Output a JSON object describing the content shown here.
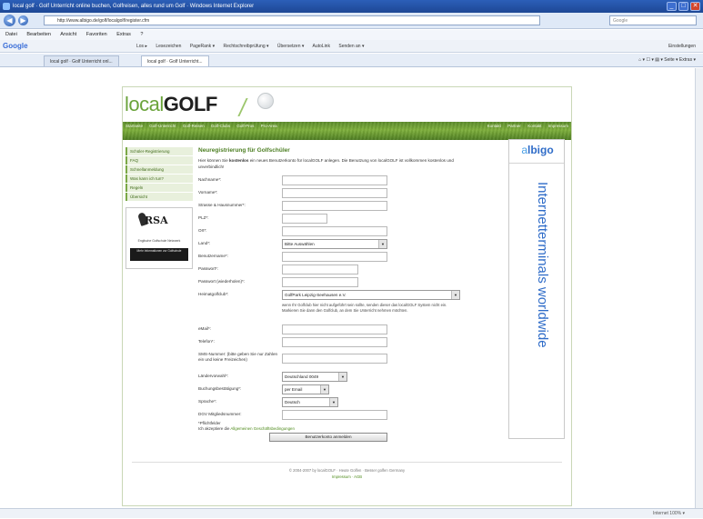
{
  "window": {
    "title": "local golf · Golf Unterricht online buchen, Golfreisen, alles rund um Golf · Windows Internet Explorer",
    "controls": [
      "_",
      "□",
      "✕"
    ]
  },
  "addressbar": {
    "url": "http://www.albigo.de/golf/localgolf/register.cfm",
    "search_placeholder": "Google"
  },
  "menubar": [
    "Datei",
    "Bearbeiten",
    "Ansicht",
    "Favoriten",
    "Extras",
    "?"
  ],
  "google_toolbar": {
    "logo": "Google",
    "items": [
      "Los ▸",
      "Lesezeichen",
      "PageRank ▾",
      "Rechtschreibprüfung ▾",
      "Übersetzen ▾",
      "AutoLink",
      "Senden an ▾"
    ],
    "settings": "Einstellungen"
  },
  "tabs": [
    {
      "label": "local golf · Golf Unterricht onl...",
      "active": false
    },
    {
      "label": "local golf · Golf Unterricht...",
      "active": true
    }
  ],
  "tab_tools": "⌂ ▾  ☐ ▾  ▤ ▾  Seite ▾  Extras ▾",
  "statusbar": {
    "left": "",
    "right": "Internet     100% ▾"
  },
  "site": {
    "logo_light": "local",
    "logo_bold": "GOLF",
    "topnav": [
      "Startseite",
      "Golf-Unterricht",
      "Golf-Reisen",
      "Golf-Clubs",
      "Golf-Pros",
      "Pro-Area"
    ],
    "topnav_right": [
      "Kontakt",
      "Partner",
      "Kontakt",
      "Impressum"
    ],
    "sidenav": [
      "Schüler-Registrierung",
      "FAQ",
      "Schnellanmeldung",
      "Was kann ich tun?",
      "Regeln",
      "Übersicht"
    ],
    "rsa": {
      "logo": "RSA",
      "caption": "Englische Golfschule Netzwerk",
      "bar": "Mehr Informationen zur Golfschule"
    },
    "heading": "Neuregistrierung für Golfschüler",
    "intro_a": "Hier können Sie ",
    "intro_bold": "kostenlos",
    "intro_b": " ein neues Benutzerkonto für localGOLF anlegen. Die Benutzung von localGOLF ist vollkommen kostenlos und unverbindlich!",
    "fields": [
      {
        "label": "Nachname*:",
        "type": "input",
        "w": 116
      },
      {
        "label": "Vorname*:",
        "type": "input",
        "w": 116
      },
      {
        "label": "Strasse & Hausnummer*:",
        "type": "input",
        "w": 116
      },
      {
        "label": "PLZ*:",
        "type": "input",
        "w": 50
      },
      {
        "label": "Ort*:",
        "type": "input",
        "w": 116
      },
      {
        "label": "Land*:",
        "type": "select",
        "value": "Bitte Auswählen",
        "w": 116
      },
      {
        "label": "Benutzername*:",
        "type": "input",
        "w": 116
      },
      {
        "label": "Passwort*:",
        "type": "input",
        "w": 84
      },
      {
        "label": "Passwort (wiederholen)*:",
        "type": "input",
        "w": 84
      }
    ],
    "homegolfclub": {
      "label": "Heimatgolfclub*:",
      "value": "GolfPark Leipzig-Seehausen e.V.",
      "hint": "wenn Ihr Golfclub hier nicht aufgeführt sein sollte, senden dieser das localGOLF System nicht ein. Markieren Sie dann den Golfclub, an dem Sie Unterricht nehmen möchten."
    },
    "fields2": [
      {
        "label": "eMail*:",
        "type": "input",
        "w": 116
      },
      {
        "label": "Telefon*:",
        "type": "input",
        "w": 116
      }
    ],
    "sms": {
      "label": "SMS-Nummer: (bitte geben Sie nur Zahlen ein und keine Freizeichen)",
      "w": 116
    },
    "selects": [
      {
        "label": "Ländervorwahl*:",
        "value": "Deutschland 0049",
        "w": 72
      },
      {
        "label": "Buchungsbestätigung*:",
        "value": "per Email",
        "w": 52
      },
      {
        "label": "Sprache*:",
        "value": "Deutsch",
        "w": 62
      }
    ],
    "dgv": {
      "label": "DGV Mitgliedsnummer:",
      "w": 116
    },
    "required_note": "*Pflichtfelder",
    "terms_a": "Ich akzeptiere die ",
    "terms_link": "Allgemeinen Geschäftsbedingungen",
    "submit": "Benutzerkonto anmelden",
    "ad": {
      "logo_a": "a",
      "logo_b": "lbigo",
      "tagline": "Internetterminals worldwide"
    },
    "footer_a": "© 2004-2007 by localGOLF · Heute Golfen · Besser golfen Germany",
    "footer_b": "Impressum · AGB"
  }
}
